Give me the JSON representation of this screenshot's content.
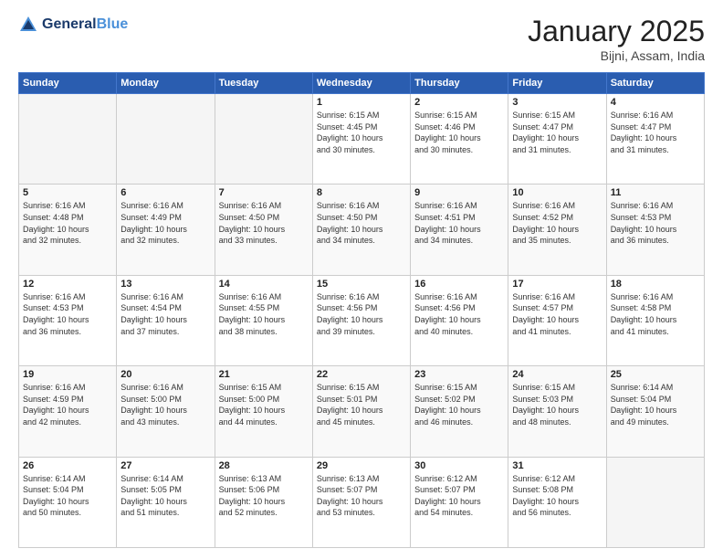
{
  "header": {
    "logo_line1": "General",
    "logo_line2": "Blue",
    "month": "January 2025",
    "location": "Bijni, Assam, India"
  },
  "weekdays": [
    "Sunday",
    "Monday",
    "Tuesday",
    "Wednesday",
    "Thursday",
    "Friday",
    "Saturday"
  ],
  "weeks": [
    [
      {
        "day": "",
        "info": ""
      },
      {
        "day": "",
        "info": ""
      },
      {
        "day": "",
        "info": ""
      },
      {
        "day": "1",
        "info": "Sunrise: 6:15 AM\nSunset: 4:45 PM\nDaylight: 10 hours\nand 30 minutes."
      },
      {
        "day": "2",
        "info": "Sunrise: 6:15 AM\nSunset: 4:46 PM\nDaylight: 10 hours\nand 30 minutes."
      },
      {
        "day": "3",
        "info": "Sunrise: 6:15 AM\nSunset: 4:47 PM\nDaylight: 10 hours\nand 31 minutes."
      },
      {
        "day": "4",
        "info": "Sunrise: 6:16 AM\nSunset: 4:47 PM\nDaylight: 10 hours\nand 31 minutes."
      }
    ],
    [
      {
        "day": "5",
        "info": "Sunrise: 6:16 AM\nSunset: 4:48 PM\nDaylight: 10 hours\nand 32 minutes."
      },
      {
        "day": "6",
        "info": "Sunrise: 6:16 AM\nSunset: 4:49 PM\nDaylight: 10 hours\nand 32 minutes."
      },
      {
        "day": "7",
        "info": "Sunrise: 6:16 AM\nSunset: 4:50 PM\nDaylight: 10 hours\nand 33 minutes."
      },
      {
        "day": "8",
        "info": "Sunrise: 6:16 AM\nSunset: 4:50 PM\nDaylight: 10 hours\nand 34 minutes."
      },
      {
        "day": "9",
        "info": "Sunrise: 6:16 AM\nSunset: 4:51 PM\nDaylight: 10 hours\nand 34 minutes."
      },
      {
        "day": "10",
        "info": "Sunrise: 6:16 AM\nSunset: 4:52 PM\nDaylight: 10 hours\nand 35 minutes."
      },
      {
        "day": "11",
        "info": "Sunrise: 6:16 AM\nSunset: 4:53 PM\nDaylight: 10 hours\nand 36 minutes."
      }
    ],
    [
      {
        "day": "12",
        "info": "Sunrise: 6:16 AM\nSunset: 4:53 PM\nDaylight: 10 hours\nand 36 minutes."
      },
      {
        "day": "13",
        "info": "Sunrise: 6:16 AM\nSunset: 4:54 PM\nDaylight: 10 hours\nand 37 minutes."
      },
      {
        "day": "14",
        "info": "Sunrise: 6:16 AM\nSunset: 4:55 PM\nDaylight: 10 hours\nand 38 minutes."
      },
      {
        "day": "15",
        "info": "Sunrise: 6:16 AM\nSunset: 4:56 PM\nDaylight: 10 hours\nand 39 minutes."
      },
      {
        "day": "16",
        "info": "Sunrise: 6:16 AM\nSunset: 4:56 PM\nDaylight: 10 hours\nand 40 minutes."
      },
      {
        "day": "17",
        "info": "Sunrise: 6:16 AM\nSunset: 4:57 PM\nDaylight: 10 hours\nand 41 minutes."
      },
      {
        "day": "18",
        "info": "Sunrise: 6:16 AM\nSunset: 4:58 PM\nDaylight: 10 hours\nand 41 minutes."
      }
    ],
    [
      {
        "day": "19",
        "info": "Sunrise: 6:16 AM\nSunset: 4:59 PM\nDaylight: 10 hours\nand 42 minutes."
      },
      {
        "day": "20",
        "info": "Sunrise: 6:16 AM\nSunset: 5:00 PM\nDaylight: 10 hours\nand 43 minutes."
      },
      {
        "day": "21",
        "info": "Sunrise: 6:15 AM\nSunset: 5:00 PM\nDaylight: 10 hours\nand 44 minutes."
      },
      {
        "day": "22",
        "info": "Sunrise: 6:15 AM\nSunset: 5:01 PM\nDaylight: 10 hours\nand 45 minutes."
      },
      {
        "day": "23",
        "info": "Sunrise: 6:15 AM\nSunset: 5:02 PM\nDaylight: 10 hours\nand 46 minutes."
      },
      {
        "day": "24",
        "info": "Sunrise: 6:15 AM\nSunset: 5:03 PM\nDaylight: 10 hours\nand 48 minutes."
      },
      {
        "day": "25",
        "info": "Sunrise: 6:14 AM\nSunset: 5:04 PM\nDaylight: 10 hours\nand 49 minutes."
      }
    ],
    [
      {
        "day": "26",
        "info": "Sunrise: 6:14 AM\nSunset: 5:04 PM\nDaylight: 10 hours\nand 50 minutes."
      },
      {
        "day": "27",
        "info": "Sunrise: 6:14 AM\nSunset: 5:05 PM\nDaylight: 10 hours\nand 51 minutes."
      },
      {
        "day": "28",
        "info": "Sunrise: 6:13 AM\nSunset: 5:06 PM\nDaylight: 10 hours\nand 52 minutes."
      },
      {
        "day": "29",
        "info": "Sunrise: 6:13 AM\nSunset: 5:07 PM\nDaylight: 10 hours\nand 53 minutes."
      },
      {
        "day": "30",
        "info": "Sunrise: 6:12 AM\nSunset: 5:07 PM\nDaylight: 10 hours\nand 54 minutes."
      },
      {
        "day": "31",
        "info": "Sunrise: 6:12 AM\nSunset: 5:08 PM\nDaylight: 10 hours\nand 56 minutes."
      },
      {
        "day": "",
        "info": ""
      }
    ]
  ]
}
